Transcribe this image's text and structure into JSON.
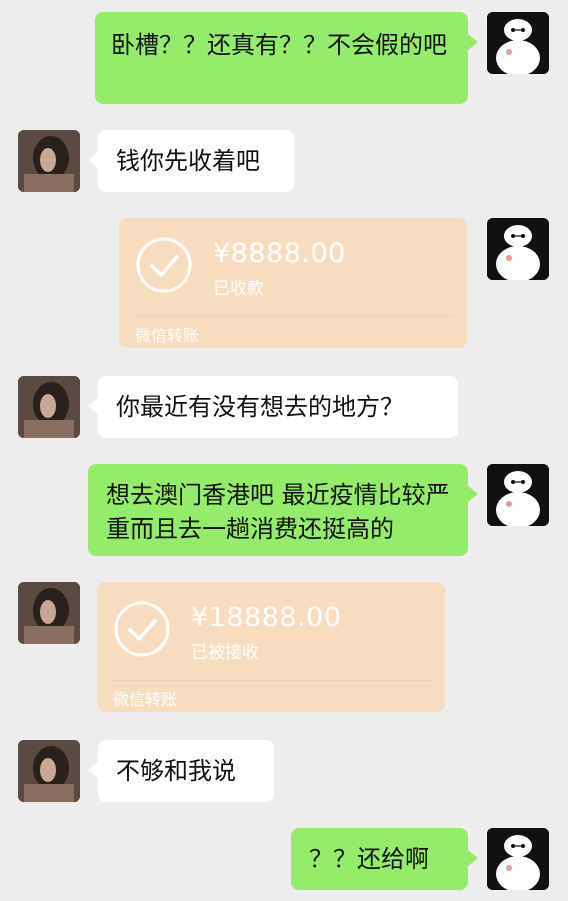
{
  "messages": [
    {
      "text": "卧槽？？还真有？？不会假的吧"
    },
    {
      "text": "钱你先收着吧"
    },
    {
      "transfer": {
        "amount": "¥8888.00",
        "status": "已收款",
        "label": "微信转账"
      }
    },
    {
      "text": "你最近有没有想去的地方？"
    },
    {
      "text": "想去澳门香港吧 最近疫情比较严重而且去一趟消费还挺高的"
    },
    {
      "transfer": {
        "amount": "¥18888.00",
        "status": "已被接收",
        "label": "微信转账"
      }
    },
    {
      "text": "不够和我说"
    },
    {
      "text": "？？还给啊"
    }
  ],
  "colors": {
    "background": "#ededed",
    "sent_bubble": "#95ec69",
    "received_bubble": "#ffffff",
    "transfer_card": "#f8dcc0"
  },
  "icons": {
    "self_avatar": "baymax-avatar",
    "other_avatar": "girl-photo-avatar",
    "transfer_status": "check-circle-icon"
  }
}
